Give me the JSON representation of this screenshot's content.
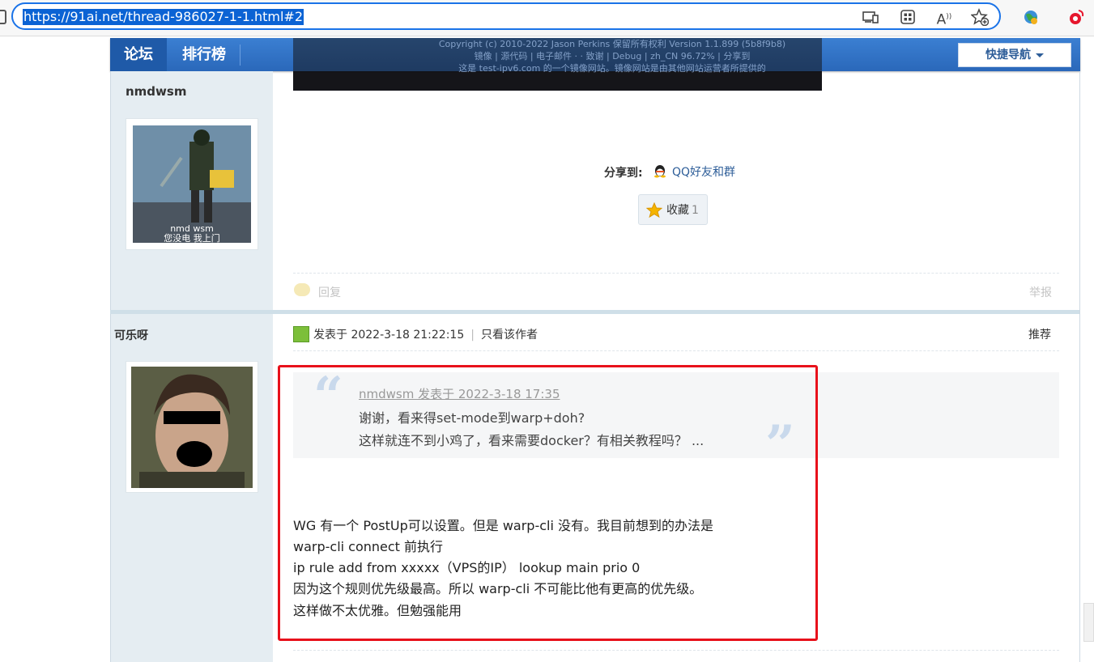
{
  "browser": {
    "url": "https://91ai.net/thread-986027-1-1.html#2",
    "icons": [
      "lock-icon",
      "device-icon",
      "apps-icon",
      "read-aloud-icon",
      "favorite-add-icon",
      "extension-globe-icon",
      "weibo-icon"
    ]
  },
  "nav": {
    "tabs": [
      "论坛",
      "排行榜"
    ],
    "quick_nav_label": "快捷导航",
    "overlay_lines": [
      "Copyright (c) 2010-2022 Jason Perkins 保留所有权利   Version 1.1.899 (5b8f9b8)",
      "镜像 | 源代码 | 电子邮件 · · 致谢 | Debug |     zh_CN 96.72% | 分享到",
      "这是 test-ipv6.com 的一个镜像网站。镜像网站是由其他网站运营者所提供的"
    ]
  },
  "post1": {
    "username": "nmdwsm",
    "avatar_caption_1": "nmd wsm",
    "avatar_caption_2": "您没电 我上门",
    "share_label": "分享到:",
    "share_target": "QQ好友和群",
    "favorite_label": "收藏",
    "favorite_count": "1",
    "reply_label": "回复",
    "report_label": "举报"
  },
  "post2": {
    "username": "可乐呀",
    "meta_prefix": "发表于",
    "meta_time": "2022-3-18 21:22:15",
    "author_only": "只看该作者",
    "recommend": "推荐",
    "quote": {
      "header": "nmdwsm 发表于 2022-3-18 17:35",
      "lines": [
        "谢谢，看来得set-mode到warp+doh?",
        "这样就连不到小鸡了，看来需要docker？有相关教程吗？ ..."
      ]
    },
    "body": [
      "WG 有一个 PostUp可以设置。但是 warp-cli 没有。我目前想到的办法是",
      "warp-cli connect 前执行",
      "ip rule add from xxxxx（VPS的IP） lookup main prio 0",
      "因为这个规则优先级最高。所以 warp-cli 不可能比他有更高的优先级。",
      "这样做不太优雅。但勉强能用"
    ]
  },
  "colors": {
    "accent": "#2a68ba",
    "highlight_box": "#e8111b",
    "link": "#2d5d98"
  }
}
